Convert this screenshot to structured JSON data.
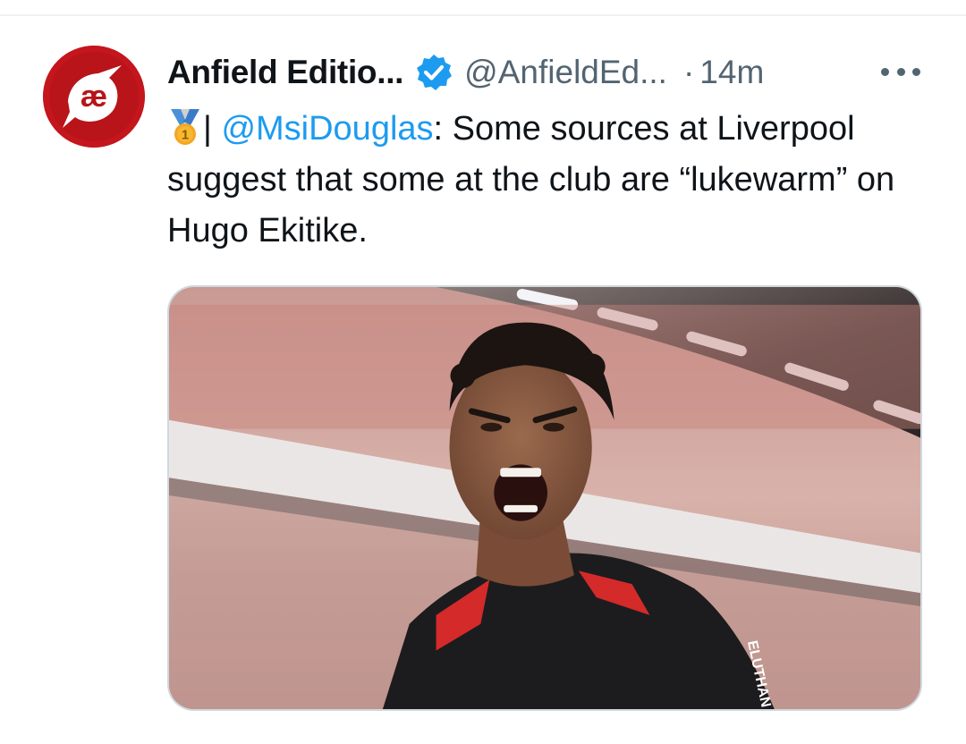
{
  "tweet": {
    "author": {
      "display_name": "Anfield Editio...",
      "handle": "@AnfieldEd...",
      "verified": true,
      "avatar_text": "æ"
    },
    "separator": "·",
    "time": "14m",
    "body": {
      "prefix_icon": "first-place-medal-icon",
      "pipe": "|",
      "mention": "@MsiDouglas",
      "text": ": Some sources at Liverpool suggest that some at the club are “lukewarm” on Hugo Ekitike."
    },
    "media": {
      "kit_text": "ELUTHAN"
    }
  },
  "colors": {
    "link": "#1d9bf0",
    "secondary_text": "#536471",
    "avatar_bg": "#c4161c",
    "verified_badge": "#1d9bf0"
  }
}
